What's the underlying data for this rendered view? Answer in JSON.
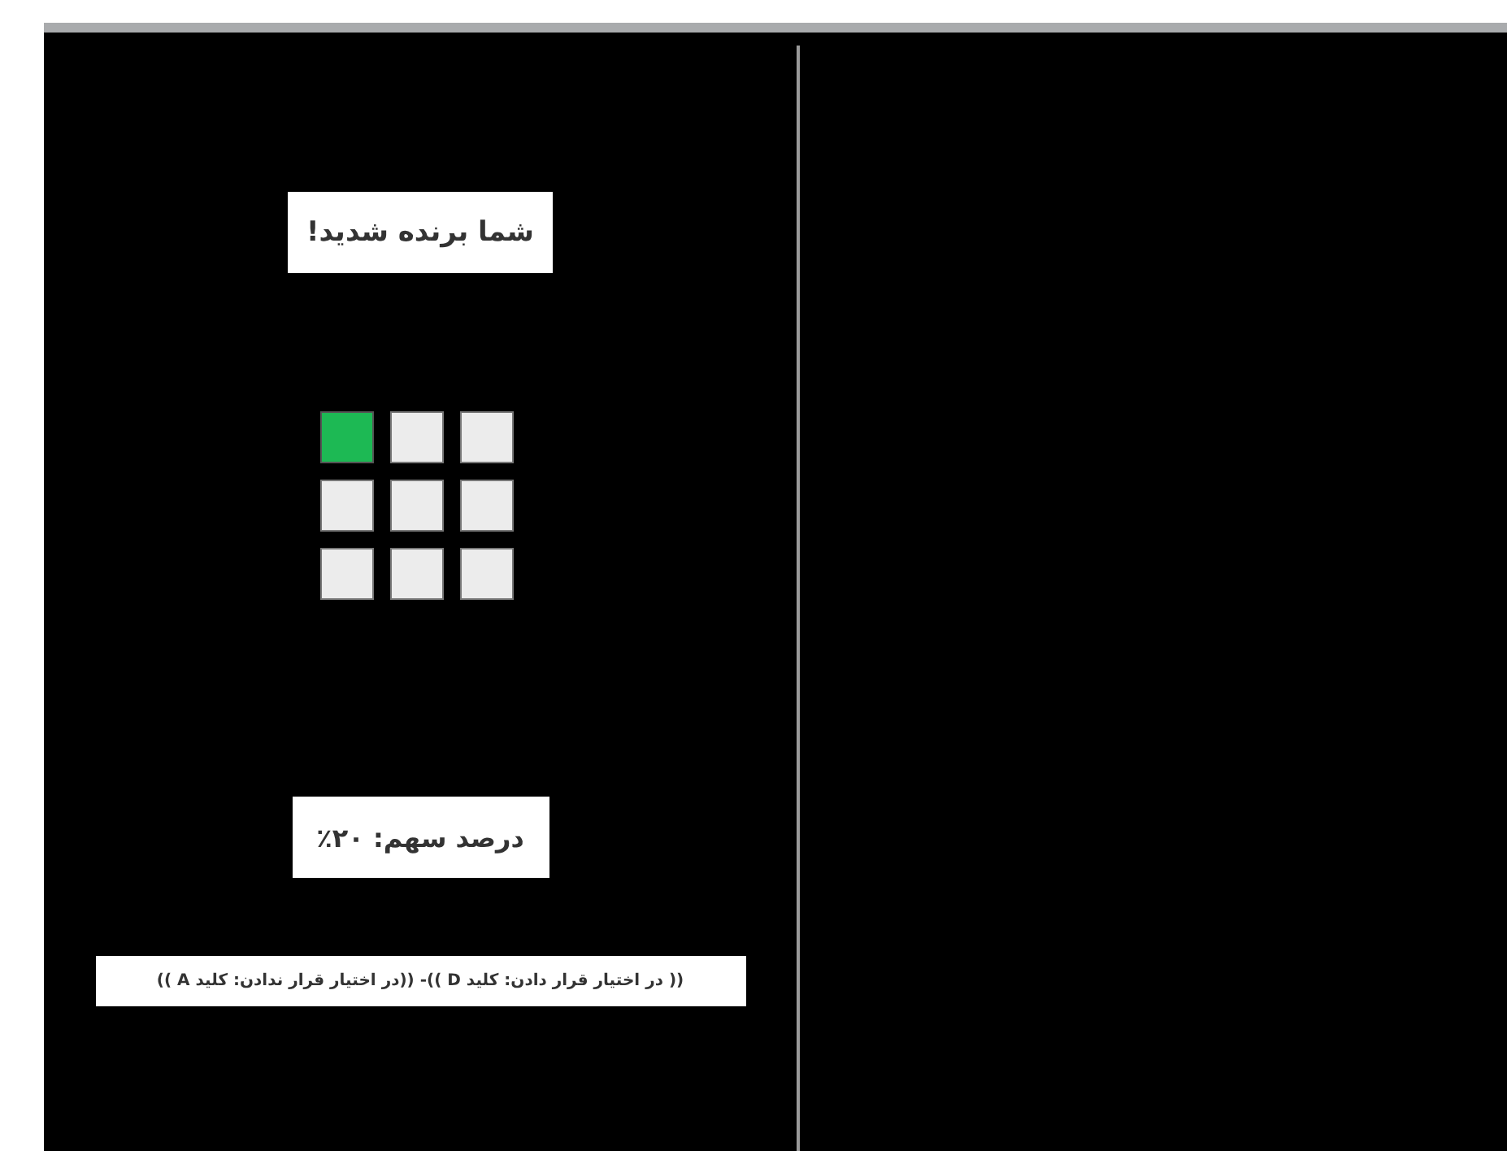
{
  "result": {
    "title": "شما برنده شدید!"
  },
  "grid": {
    "cells": [
      {
        "selected": true
      },
      {
        "selected": false
      },
      {
        "selected": false
      },
      {
        "selected": false
      },
      {
        "selected": false
      },
      {
        "selected": false
      },
      {
        "selected": false
      },
      {
        "selected": false
      },
      {
        "selected": false
      }
    ]
  },
  "share": {
    "text": "درصد سهم: ۲۰٪"
  },
  "instructions": {
    "text": "(( در اختیار قرار دادن: کلید D ))- ((در اختیار قرار ندادن: کلید A ))"
  }
}
